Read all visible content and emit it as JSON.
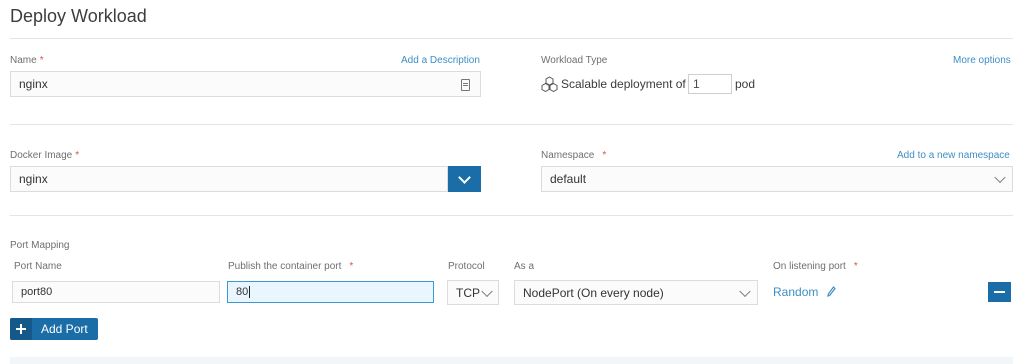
{
  "page": {
    "title": "Deploy Workload"
  },
  "name_field": {
    "label": "Name",
    "required_mark": "*",
    "value": "nginx",
    "link": "Add a Description"
  },
  "workload": {
    "label": "Workload Type",
    "more_options": "More options",
    "prefix": "Scalable deployment of",
    "count": "1",
    "suffix": "pod"
  },
  "docker_image": {
    "label": "Docker Image",
    "required_mark": "*",
    "value": "nginx"
  },
  "namespace": {
    "label": "Namespace",
    "required_mark": "*",
    "link": "Add to a new namespace",
    "value": "default"
  },
  "port_mapping": {
    "label": "Port Mapping",
    "headers": {
      "port_name": "Port Name",
      "publish": "Publish the container port",
      "publish_required": "*",
      "protocol": "Protocol",
      "as_a": "As a",
      "listening": "On listening port",
      "listening_required": "*"
    },
    "row": {
      "port_name": "port80",
      "publish_port": "80",
      "protocol": "TCP",
      "as_a": "NodePort (On every node)",
      "listening": "Random"
    },
    "add_port": "Add Port"
  },
  "colors": {
    "accent": "#1a6da6",
    "link": "#3d8fc4",
    "required": "#d9534f"
  },
  "icons": [
    "note-icon",
    "cubes-icon",
    "chevron-down-icon",
    "pencil-icon",
    "plus-icon",
    "minus-icon"
  ]
}
